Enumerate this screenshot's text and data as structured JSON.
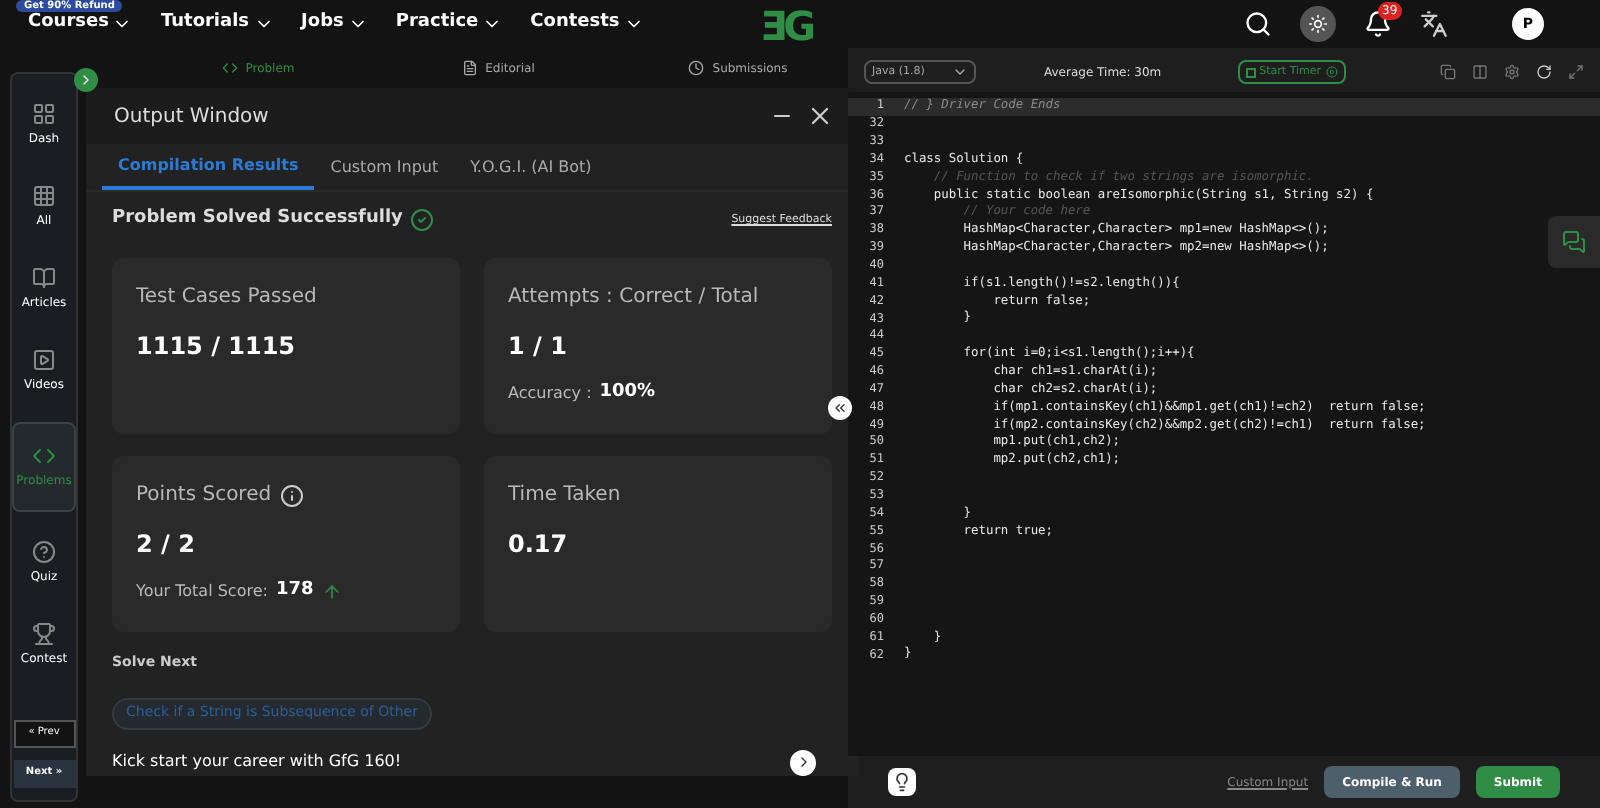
{
  "promo": "Get 90% Refund",
  "nav": [
    {
      "label": "Courses"
    },
    {
      "label": "Tutorials"
    },
    {
      "label": "Jobs"
    },
    {
      "label": "Practice"
    },
    {
      "label": "Contests"
    }
  ],
  "logo": "ƎG",
  "notifications": "39",
  "avatar": "P",
  "sidebar": [
    {
      "label": "Dash",
      "selected": false
    },
    {
      "label": "All",
      "selected": false
    },
    {
      "label": "Articles",
      "selected": false
    },
    {
      "label": "Videos",
      "selected": false
    },
    {
      "label": "Problems",
      "selected": true
    },
    {
      "label": "Quiz",
      "selected": false
    },
    {
      "label": "Contest",
      "selected": false
    }
  ],
  "prev": "« Prev",
  "next": "Next »",
  "problem_tabs": [
    {
      "label": "Problem",
      "selected": true
    },
    {
      "label": "Editorial",
      "selected": false
    },
    {
      "label": "Submissions",
      "selected": false
    }
  ],
  "output": {
    "title": "Output Window",
    "tabs": [
      {
        "label": "Compilation Results",
        "selected": true
      },
      {
        "label": "Custom Input",
        "selected": false
      },
      {
        "label": "Y.O.G.I. (AI Bot)",
        "selected": false
      }
    ],
    "status": "Problem Solved Successfully",
    "feedback": "Suggest Feedback",
    "cards": [
      {
        "kind": "plain",
        "label": "Test Cases Passed",
        "value": "1115 / 1115"
      },
      {
        "kind": "stat",
        "label": "Attempts : Correct / Total",
        "value": "1 / 1",
        "sub_label": "Accuracy :",
        "sub_value": "100%"
      },
      {
        "kind": "score",
        "label": "Points Scored",
        "value": "2 / 2",
        "sub_label": "Your Total Score:",
        "sub_value": "178"
      },
      {
        "kind": "plain",
        "label": "Time Taken",
        "value": "0.17"
      }
    ],
    "solve_next": "Solve Next",
    "next_problem": "Check if a String is Subsequence of Other",
    "promo_line": "Kick start your career with GfG 160!"
  },
  "editor": {
    "language": "Java (1.8)",
    "avg_time": "Average Time: 30m",
    "timer": "Start Timer",
    "lines": [
      {
        "n": "1",
        "kind": "folded",
        "code": "// } Driver Code Ends"
      },
      {
        "n": "32",
        "kind": "code"
      },
      {
        "n": "33",
        "kind": "code"
      },
      {
        "n": "34",
        "kind": "code",
        "code": "class Solution {"
      },
      {
        "n": "35",
        "kind": "comment",
        "code": "    // Function to check if two strings are isomorphic."
      },
      {
        "n": "36",
        "kind": "code",
        "code": "    public static boolean areIsomorphic(String s1, String s2) {"
      },
      {
        "n": "37",
        "kind": "comment",
        "code": "        // Your code here"
      },
      {
        "n": "38",
        "kind": "code",
        "code": "        HashMap<Character,Character> mp1=new HashMap<>();"
      },
      {
        "n": "39",
        "kind": "code",
        "code": "        HashMap<Character,Character> mp2=new HashMap<>();"
      },
      {
        "n": "40",
        "kind": "code"
      },
      {
        "n": "41",
        "kind": "code",
        "code": "        if(s1.length()!=s2.length()){"
      },
      {
        "n": "42",
        "kind": "code",
        "code": "            return false;"
      },
      {
        "n": "43",
        "kind": "code",
        "code": "        }"
      },
      {
        "n": "44",
        "kind": "code"
      },
      {
        "n": "45",
        "kind": "code",
        "code": "        for(int i=0;i<s1.length();i++){"
      },
      {
        "n": "46",
        "kind": "code",
        "code": "            char ch1=s1.charAt(i);"
      },
      {
        "n": "47",
        "kind": "code",
        "code": "            char ch2=s2.charAt(i);"
      },
      {
        "n": "48",
        "kind": "code",
        "code": "            if(mp1.containsKey(ch1)&&mp1.get(ch1)!=ch2)  return false;"
      },
      {
        "n": "49",
        "kind": "code",
        "code": "            if(mp2.containsKey(ch2)&&mp2.get(ch2)!=ch1)  return false;"
      },
      {
        "n": "50",
        "kind": "code",
        "code": "            mp1.put(ch1,ch2);"
      },
      {
        "n": "51",
        "kind": "code",
        "code": "            mp2.put(ch2,ch1);"
      },
      {
        "n": "52",
        "kind": "code"
      },
      {
        "n": "53",
        "kind": "code"
      },
      {
        "n": "54",
        "kind": "code",
        "code": "        }"
      },
      {
        "n": "55",
        "kind": "code",
        "code": "        return true;"
      },
      {
        "n": "56",
        "kind": "code"
      },
      {
        "n": "57",
        "kind": "code"
      },
      {
        "n": "58",
        "kind": "code"
      },
      {
        "n": "59",
        "kind": "code"
      },
      {
        "n": "60",
        "kind": "code"
      },
      {
        "n": "61",
        "kind": "code",
        "code": "    }"
      },
      {
        "n": "62",
        "kind": "code",
        "code": "}"
      }
    ],
    "custom_input": "Custom Input",
    "compile": "Compile & Run",
    "submit": "Submit"
  }
}
